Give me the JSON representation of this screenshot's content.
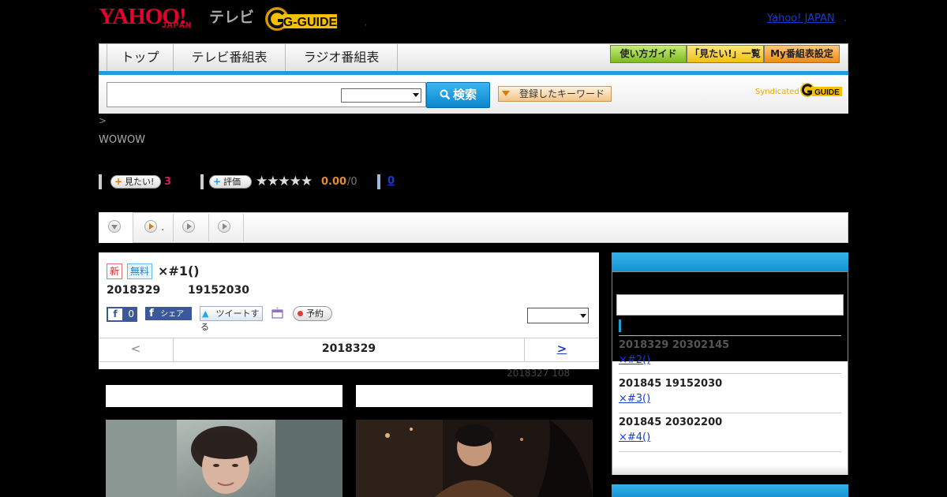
{
  "header": {
    "yahoo_logo": "YAHOO!",
    "japan_logo": "JAPAN",
    "tv_label": "テレビ",
    "gguide_logo": "G-GUIDE",
    "yahoo_japan_link": "Yahoo! JAPAN",
    "link_separator": ".",
    "small_dot": ","
  },
  "nav": {
    "tabs": [
      "トップ",
      "テレビ番組表",
      "ラジオ番組表"
    ],
    "right_buttons": [
      "使い方ガイド",
      "「見たい!」一覧",
      "My番組表設定"
    ]
  },
  "search": {
    "input_value": "",
    "select_value": "",
    "button_label": "検索",
    "keyword_button_label": "登録したキーワード",
    "syndicated_label": "Syndicated",
    "syndicated_logo": "GUIDE"
  },
  "breadcrumb": ">",
  "channel": "WOWOW",
  "stats": {
    "want_label": "見たい!",
    "want_count": "3",
    "rate_label": "評価",
    "stars": "★★★★★",
    "rating_value": "0.00",
    "rating_count": "/0",
    "comment_count": "0"
  },
  "tabstrip": {
    "tab2_label": "."
  },
  "program": {
    "badge_new": "新",
    "badge_free": "無料",
    "title": "×#1()",
    "date": "2018329",
    "time": "19152030",
    "fb_like_count": "0",
    "fb_share_label": "シェア",
    "tweet_label": "ツイートする",
    "reserve_label": "予約",
    "select_value": ""
  },
  "date_nav": {
    "prev": "<",
    "current": "2018329",
    "next": ">"
  },
  "meta_line": "2018327  108",
  "sidebar": {
    "items": [
      {
        "date": "2018329  20302145",
        "link": "×#2()"
      },
      {
        "date": "201845  19152030",
        "link": "×#3()"
      },
      {
        "date": "201845  20302200",
        "link": "×#4()"
      }
    ]
  },
  "colors": {
    "accent_blue": "#1e9ed8",
    "yahoo_red": "#e6002d",
    "link_blue": "#1a3ccc"
  }
}
